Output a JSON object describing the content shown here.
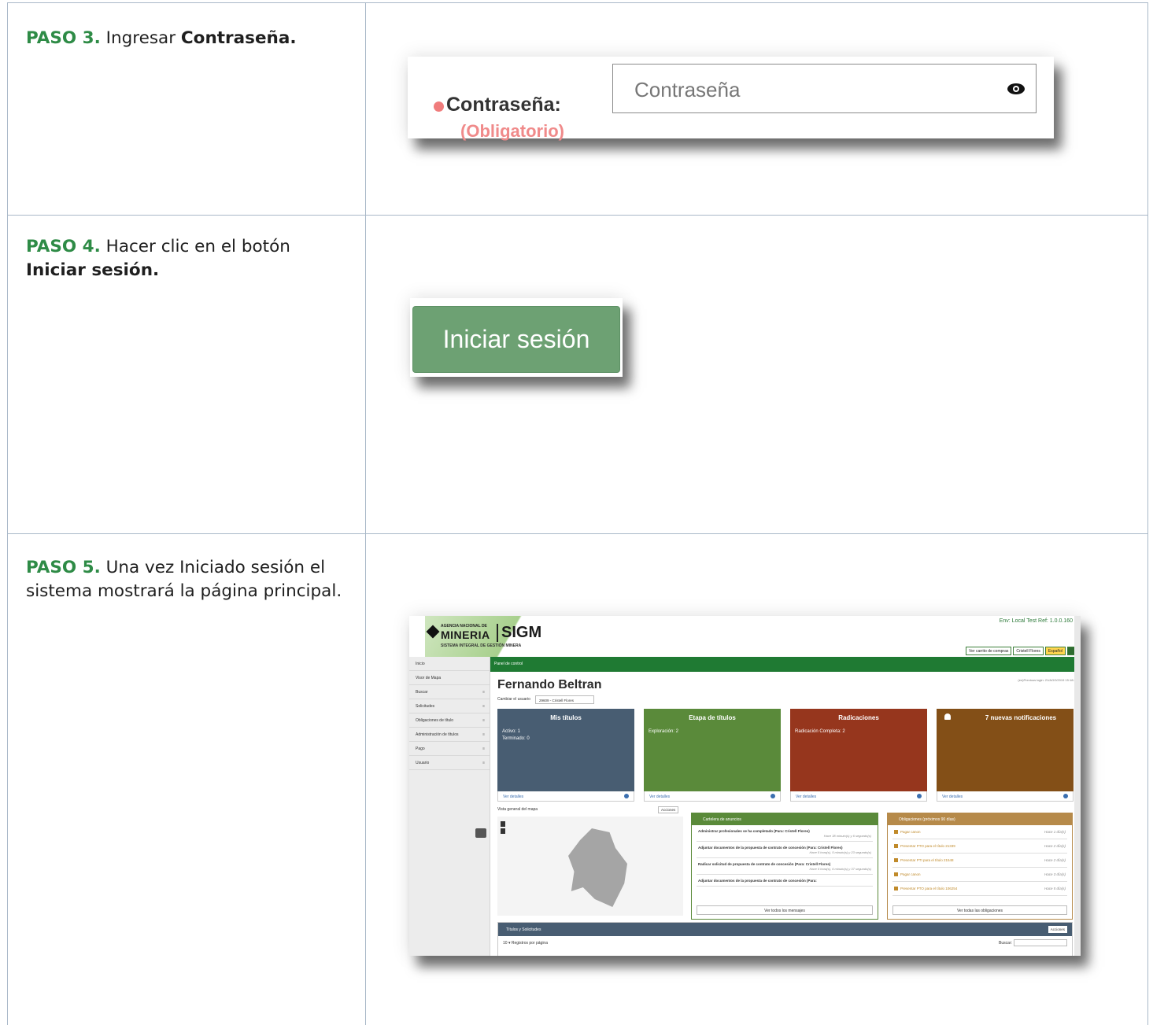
{
  "steps": {
    "paso3": {
      "label": "PASO 3.",
      "text_before": " Ingresar ",
      "bold": "Contraseña."
    },
    "paso4": {
      "label": "PASO 4.",
      "text_before": " Hacer clic en el botón ",
      "bold": "Iniciar sesión."
    },
    "paso5": {
      "label": "PASO 5.",
      "text": " Una vez Iniciado sesión el sistema mostrará la página principal."
    }
  },
  "password_field": {
    "label": "Contraseña:",
    "required": "(Obligatorio)",
    "placeholder": "Contraseña",
    "icon": "eye-icon"
  },
  "login_button": {
    "label": "Iniciar sesión"
  },
  "app": {
    "logo": {
      "agencia": "AGENCIA NACIONAL DE",
      "mineria": "MINERIA",
      "sigm": "SIGM",
      "subtitle": "SISTEMA INTEGRAL DE GESTIÓN MINERA"
    },
    "env": "Env: Local Test Ref: 1.0.0.160",
    "top_buttons": {
      "cart": "Ver carrito de compras",
      "user": "Cristell Flores",
      "lang": "Español"
    },
    "breadcrumb": "Panel de control",
    "sidebar": [
      {
        "label": "Inicio"
      },
      {
        "label": "Visor de Mapa"
      },
      {
        "label": "Buscar"
      },
      {
        "label": "Solicitudes"
      },
      {
        "label": "Obligaciones de título"
      },
      {
        "label": "Administración de títulos"
      },
      {
        "label": "Pago"
      },
      {
        "label": "Usuario"
      }
    ],
    "user_name": "Fernando Beltran",
    "last_login": "(en)Previous login: 21/AGO/2019 15:18:34",
    "change_user_label": "Cambiar el usuario",
    "change_user_value": "29609 - Cristell Flores",
    "tiles": {
      "mis_titulos": {
        "title": "Mis títulos",
        "line1": "Activo: 1",
        "line2": "Terminado: 0",
        "footer": "Ver detalles"
      },
      "etapa": {
        "title": "Etapa de títulos",
        "line1": "Exploración: 2",
        "footer": "Ver detalles"
      },
      "radicaciones": {
        "title": "Radicaciones",
        "line1": "Radicación Completa: 2",
        "footer": "Ver detalles"
      },
      "notificaciones": {
        "title": "7 nuevas notificaciones",
        "footer": "Ver detalles"
      }
    },
    "map": {
      "title": "Vista general del mapa",
      "actions": "Acciones"
    },
    "anuncios": {
      "title": "Cartelera de anuncios",
      "messages": [
        {
          "text": "Administrar profesionales se ha completado (Para: Cristell Flores)",
          "time": "Hace 38 minuto(s) y 6 segundo(s)"
        },
        {
          "text": "Adjuntar documentos de la propuesta de contrato de concesión (Para: Cristell Flores)",
          "time": "Hace 5 hora(s), 5 minuto(s) y 23 segundo(s)"
        },
        {
          "text": "Radicar solicitud de propuesta de contrato de concesión (Para: Cristell Flores)",
          "time": "Hace 5 hora(s), 6 minuto(s) y 37 segundo(s)"
        },
        {
          "text": "Adjuntar documentos de la propuesta de contrato de concesión (Para:",
          "time": ""
        }
      ],
      "see_all": "Ver todos los mensajes"
    },
    "obligaciones": {
      "title": "Obligaciones (próximos 90 días)",
      "rows": [
        {
          "text": "Pagar canon",
          "when": "Hace 1 día(s)"
        },
        {
          "text": "Presentar PTO para el título 21339",
          "when": "Hace 2 día(s)"
        },
        {
          "text": "Presentar PTI para el título 21548",
          "when": "Hace 2 día(s)"
        },
        {
          "text": "Pagar canon",
          "when": "Hace 3 día(s)"
        },
        {
          "text": "Presentar PTO para el título 106254",
          "when": "Hace 5 día(s)"
        }
      ],
      "see_all": "Ver todas las obligaciones"
    },
    "titulos_table": {
      "title": "Títulos y Solicitudes",
      "actions": "Acciones",
      "per_page_value": "10",
      "per_page_label": "Registros por página",
      "search": "Buscar:"
    }
  }
}
